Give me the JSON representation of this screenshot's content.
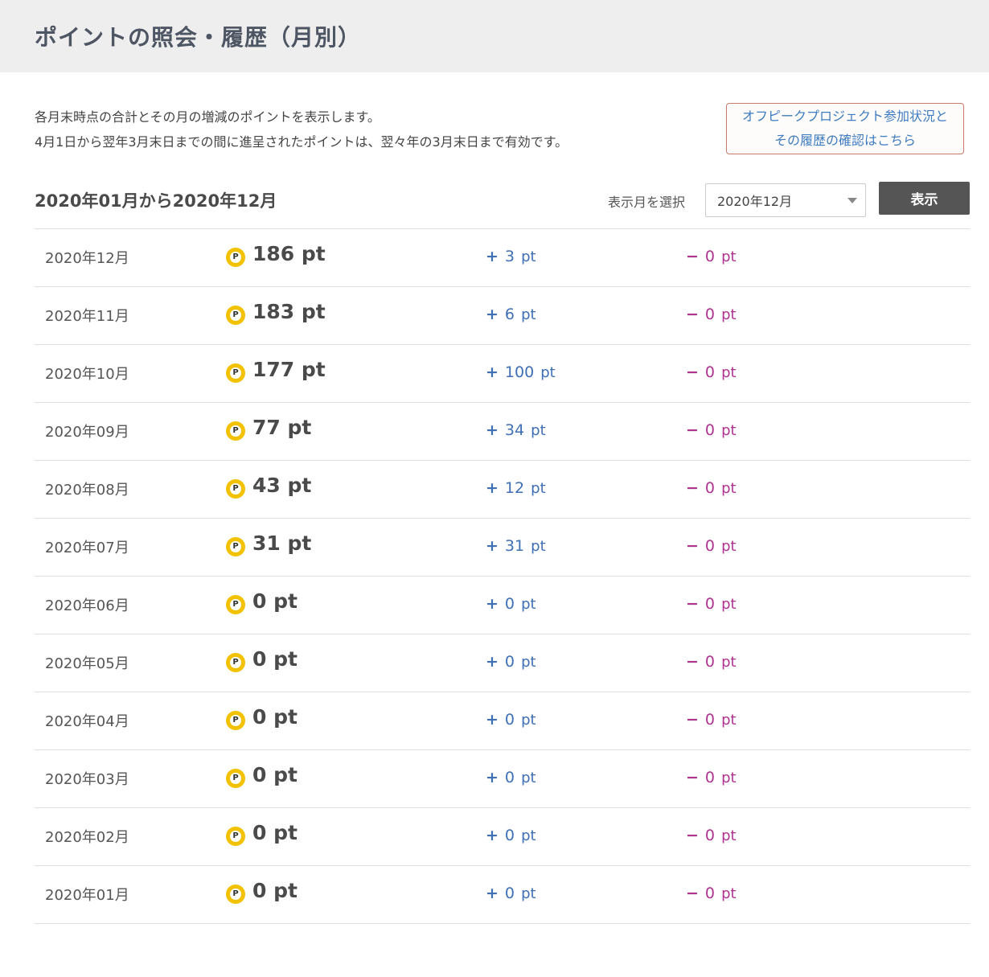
{
  "page": {
    "title": "ポイントの照会・履歴（月別）"
  },
  "intro": {
    "line1": "各月末時点の合計とその月の増減のポイントを表示します。",
    "line2": "4月1日から翌年3月末日までの間に進呈されたポイントは、翌々年の3月末日まで有効です。"
  },
  "project_link": {
    "line1": "オフピークプロジェクト参加状況と",
    "line2": "その履歴の確認はこちら"
  },
  "range": {
    "title": "2020年01月から2020年12月",
    "select_label": "表示月を選択",
    "selected_month": "2020年12月",
    "show_button": "表示"
  },
  "signs": {
    "plus": "+",
    "minus": "−"
  },
  "coin_letter": "P",
  "history": [
    {
      "month": "2020年12月",
      "total": "186 pt",
      "plus": "3",
      "minus": "0",
      "unit": "pt"
    },
    {
      "month": "2020年11月",
      "total": "183 pt",
      "plus": "6",
      "minus": "0",
      "unit": "pt"
    },
    {
      "month": "2020年10月",
      "total": "177 pt",
      "plus": "100",
      "minus": "0",
      "unit": "pt"
    },
    {
      "month": "2020年09月",
      "total": "77 pt",
      "plus": "34",
      "minus": "0",
      "unit": "pt"
    },
    {
      "month": "2020年08月",
      "total": "43 pt",
      "plus": "12",
      "minus": "0",
      "unit": "pt"
    },
    {
      "month": "2020年07月",
      "total": "31 pt",
      "plus": "31",
      "minus": "0",
      "unit": "pt"
    },
    {
      "month": "2020年06月",
      "total": "0 pt",
      "plus": "0",
      "minus": "0",
      "unit": "pt"
    },
    {
      "month": "2020年05月",
      "total": "0 pt",
      "plus": "0",
      "minus": "0",
      "unit": "pt"
    },
    {
      "month": "2020年04月",
      "total": "0 pt",
      "plus": "0",
      "minus": "0",
      "unit": "pt"
    },
    {
      "month": "2020年03月",
      "total": "0 pt",
      "plus": "0",
      "minus": "0",
      "unit": "pt"
    },
    {
      "month": "2020年02月",
      "total": "0 pt",
      "plus": "0",
      "minus": "0",
      "unit": "pt"
    },
    {
      "month": "2020年01月",
      "total": "0 pt",
      "plus": "0",
      "minus": "0",
      "unit": "pt"
    }
  ],
  "colors": {
    "header_bg": "#eeeeee",
    "title_text": "#4e5563",
    "plus": "#3f6fb5",
    "minus": "#b0338f",
    "coin": "#f2c200",
    "button_bg": "#555555",
    "link_border": "#c8796a",
    "link_text": "#3f7bc0"
  }
}
